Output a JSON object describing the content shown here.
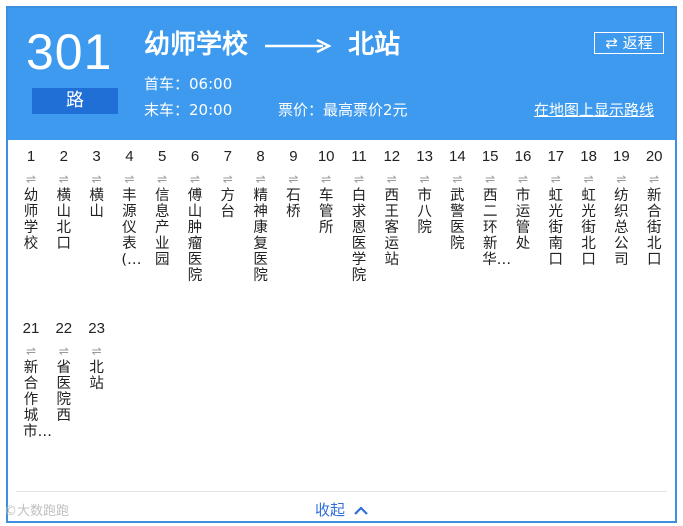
{
  "route": {
    "number": "301",
    "suffix": "路",
    "origin": "幼师学校",
    "destination": "北站",
    "first_bus_label": "首车：",
    "first_bus_time": "06:00",
    "last_bus_label": "末车：",
    "last_bus_time": "20:00",
    "fare_label": "票价：",
    "fare_value": "最高票价2元",
    "return_label": "返程",
    "map_link": "在地图上显示路线"
  },
  "stops": [
    {
      "num": "1",
      "name": "幼师学校"
    },
    {
      "num": "2",
      "name": "横山北口"
    },
    {
      "num": "3",
      "name": "横山"
    },
    {
      "num": "4",
      "name": "丰源仪表(…"
    },
    {
      "num": "5",
      "name": "信息产业园"
    },
    {
      "num": "6",
      "name": "傅山肿瘤医院"
    },
    {
      "num": "7",
      "name": "方台"
    },
    {
      "num": "8",
      "name": "精神康复医院"
    },
    {
      "num": "9",
      "name": "石桥"
    },
    {
      "num": "10",
      "name": "车管所"
    },
    {
      "num": "11",
      "name": "白求恩医学院"
    },
    {
      "num": "12",
      "name": "西王客运站"
    },
    {
      "num": "13",
      "name": "市八院"
    },
    {
      "num": "14",
      "name": "武警医院"
    },
    {
      "num": "15",
      "name": "西二环新华…"
    },
    {
      "num": "16",
      "name": "市运管处"
    },
    {
      "num": "17",
      "name": "虹光街南口"
    },
    {
      "num": "18",
      "name": "虹光街北口"
    },
    {
      "num": "19",
      "name": "纺织总公司"
    },
    {
      "num": "20",
      "name": "新合街北口"
    },
    {
      "num": "21",
      "name": "新合作城市…"
    },
    {
      "num": "22",
      "name": "省医院西"
    },
    {
      "num": "23",
      "name": "北站"
    }
  ],
  "direction_glyph": "⇌",
  "footer": {
    "collapse_label": "收起",
    "watermark": "©大数跑跑"
  }
}
